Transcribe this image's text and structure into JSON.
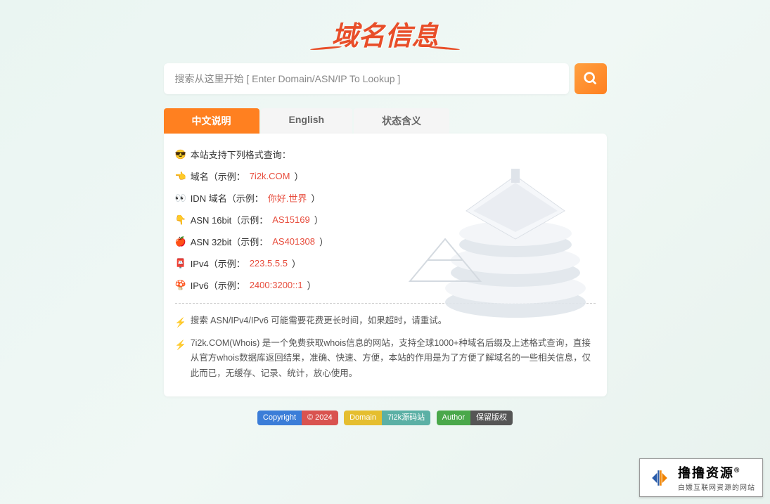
{
  "logo": {
    "text": "域名信息"
  },
  "search": {
    "placeholder": "搜索从这里开始 [ Enter Domain/ASN/IP To Lookup ]",
    "value": ""
  },
  "tabs": [
    {
      "label": "中文说明",
      "active": true
    },
    {
      "label": "English",
      "active": false
    },
    {
      "label": "状态含义",
      "active": false
    }
  ],
  "formats": {
    "intro": {
      "emoji": "😎",
      "text": "本站支持下列格式查询："
    },
    "items": [
      {
        "emoji": "👈",
        "label": "域名（示例：",
        "example": "7i2k.COM",
        "close": "）"
      },
      {
        "emoji": "👀",
        "label": "IDN 域名（示例：",
        "example": "你好.世界",
        "close": "）"
      },
      {
        "emoji": "👇",
        "label": "ASN 16bit（示例：",
        "example": "AS15169",
        "close": "）"
      },
      {
        "emoji": "🍎",
        "label": "ASN 32bit（示例：",
        "example": "AS401308",
        "close": "）"
      },
      {
        "emoji": "📮",
        "label": "IPv4（示例：",
        "example": "223.5.5.5",
        "close": "）"
      },
      {
        "emoji": "🍄",
        "label": "IPv6（示例：",
        "example": "2400:3200::1",
        "close": "）"
      }
    ]
  },
  "notes": [
    {
      "emoji": "⚡",
      "text": "搜索 ASN/IPv4/IPv6 可能需要花费更长时间，如果超时，请重试。"
    },
    {
      "emoji": "⚡",
      "text": "7i2k.COM(Whois) 是一个免费获取whois信息的网站，支持全球1000+种域名后缀及上述格式查询，直接从官方whois数据库返回结果，准确、快速、方便，本站的作用是为了方便了解域名的一些相关信息，仅此而已，无缓存、记录、统计，放心使用。"
    }
  ],
  "footer": {
    "badges": [
      {
        "labelClass": "bg-blue",
        "valueClass": "bg-red",
        "label": "Copyright",
        "value": "© 2024"
      },
      {
        "labelClass": "bg-yellow",
        "valueClass": "bg-teal",
        "label": "Domain",
        "value": "7i2k源码站"
      },
      {
        "labelClass": "bg-green",
        "valueClass": "bg-dark",
        "label": "Author",
        "value": "保留版权"
      }
    ]
  },
  "corner": {
    "main": "撸撸资源",
    "registered": "®",
    "sub": "白嫖互联网资源的网站"
  }
}
